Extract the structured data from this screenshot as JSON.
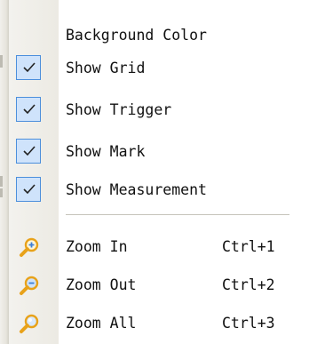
{
  "menu": {
    "toggles": [
      {
        "label": "Background Color",
        "checked": false
      },
      {
        "label": "Show Grid",
        "checked": true
      },
      {
        "label": "Show Trigger",
        "checked": true
      },
      {
        "label": "Show Mark",
        "checked": true
      },
      {
        "label": "Show Measurement",
        "checked": true
      }
    ],
    "zoom": [
      {
        "label": "Zoom In",
        "shortcut": "Ctrl+1",
        "icon": "magnifier-plus-icon"
      },
      {
        "label": "Zoom Out",
        "shortcut": "Ctrl+2",
        "icon": "magnifier-minus-icon"
      },
      {
        "label": "Zoom All",
        "shortcut": "Ctrl+3",
        "icon": "magnifier-icon"
      }
    ]
  },
  "colors": {
    "check_fill": "#cfe3fb",
    "check_border": "#4c8fdc",
    "icon_gold": "#e8a21a",
    "icon_glass": "#3d7fd6"
  }
}
